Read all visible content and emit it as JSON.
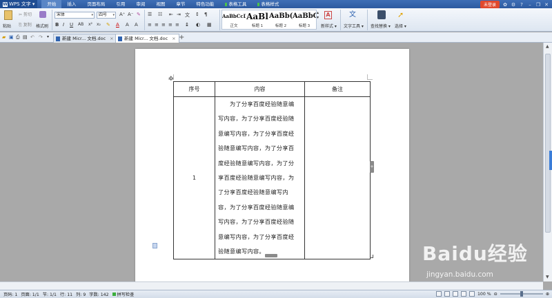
{
  "app": {
    "name": "WPS 文字"
  },
  "menu": {
    "items": [
      {
        "label": "开始",
        "active": true
      },
      {
        "label": "插入"
      },
      {
        "label": "页面布局"
      },
      {
        "label": "引用"
      },
      {
        "label": "审阅"
      },
      {
        "label": "视图"
      },
      {
        "label": "章节"
      },
      {
        "label": "特色功能"
      },
      {
        "label": "表格工具",
        "contextual": true
      },
      {
        "label": "表格样式",
        "contextual": true
      }
    ],
    "login": "未登录"
  },
  "ribbon": {
    "paste": "粘贴",
    "cut": "剪切",
    "copy": "复制",
    "format_painter": "格式刷",
    "font_name": "宋体",
    "font_size": "四号",
    "styles": [
      {
        "preview": "AaBbCcDd",
        "name": "正文"
      },
      {
        "preview": "AaBl",
        "name": "标题 1"
      },
      {
        "preview": "AaBb(",
        "name": "标题 2"
      },
      {
        "preview": "AaBbC",
        "name": "标题 3"
      }
    ],
    "new_style": "新样式",
    "text_tools": "文字工具",
    "find_replace": "查找替换",
    "select": "选择"
  },
  "tabs": [
    {
      "label": "新建 Micr... 文档.doc",
      "active": false
    },
    {
      "label": "新建 Micr... 文档.doc",
      "active": true
    }
  ],
  "table": {
    "headers": [
      "序号",
      "内容",
      "备注"
    ],
    "rows": [
      {
        "num": "1",
        "content_lines": [
          "　　为了分享百度经验随意编",
          "写内容，为了分享百度经验随",
          "意编写内容，为了分享百度经",
          "验随意编写内容，为了分享百",
          "度经验随意编写内容，为了分",
          "享百度经验随意编写内容，为",
          "了分享百度经验随意编写内",
          "容，为了分享百度经验随意编",
          "写内容，为了分享百度经验随",
          "意编写内容，为了分享百度经",
          "验随意编写内容。"
        ],
        "note": ""
      }
    ]
  },
  "status": {
    "page": "页码: 1",
    "pages": "页面: 1/1",
    "section": "节: 1/1",
    "row": "行: 11",
    "col": "列: 9",
    "words": "字数: 142",
    "spell": "拼写检查",
    "zoom": "100 %"
  },
  "watermark": {
    "brand": "Baidu经验",
    "url": "jingyan.baidu.com"
  }
}
